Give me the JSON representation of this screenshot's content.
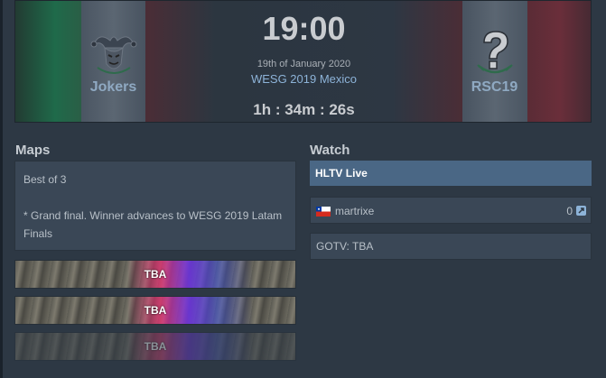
{
  "match": {
    "team1": {
      "name": "Jokers",
      "logo_icon": "jester-hat-logo"
    },
    "team2": {
      "name": "RSC19",
      "logo_icon": "question-mark-logo"
    },
    "time": "19:00",
    "date": "19th of January 2020",
    "event": "WESG 2019 Mexico",
    "countdown": "1h : 34m : 26s"
  },
  "maps": {
    "title": "Maps",
    "format": "Best of 3",
    "note": "* Grand final. Winner advances to WESG 2019 Latam Finals",
    "items": [
      {
        "label": "TBA"
      },
      {
        "label": "TBA"
      },
      {
        "label": "TBA"
      }
    ]
  },
  "watch": {
    "title": "Watch",
    "hltv_live": "HLTV Live",
    "streams": [
      {
        "flag_icon": "chile-flag-icon",
        "name": "martrixe",
        "viewers": "0",
        "link_icon": "external-link-icon"
      }
    ],
    "gotv": "GOTV: TBA"
  },
  "colors": {
    "background": "#2d3844",
    "box": "#3a4756",
    "hltv_live_bg": "#4a6785",
    "team_name": "#8fa9c2",
    "event_link": "#8db3d8"
  }
}
